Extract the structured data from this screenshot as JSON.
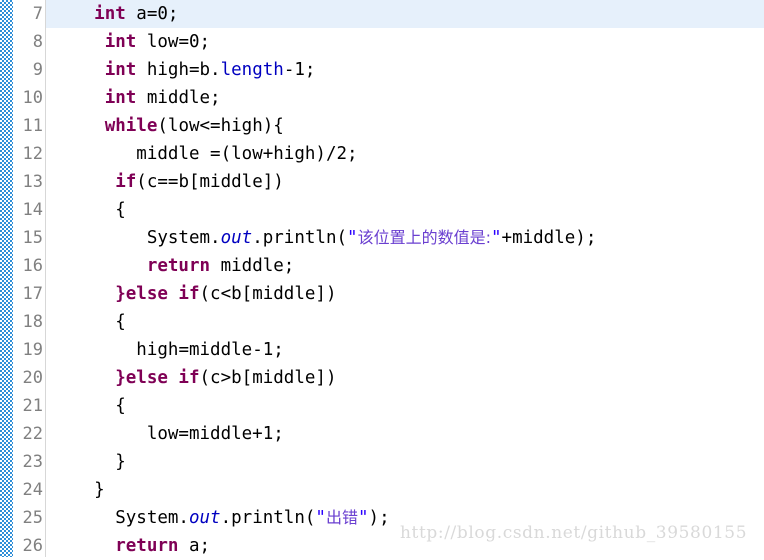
{
  "editor": {
    "language": "java",
    "first_line_number": 7,
    "line_height_px": 28,
    "current_line": 7,
    "colors": {
      "keyword": "#7f0055",
      "field": "#0000c0",
      "string": "#2a00ff",
      "plain": "#000000",
      "line_number": "#808080",
      "current_line_bg": "#e6f0fb",
      "change_strip": "#2f8fd8",
      "gutter_separator": "#d7d7d7",
      "watermark": "#d9d9d9"
    },
    "gutter": {
      "line_numbers": [
        "7",
        "8",
        "9",
        "10",
        "11",
        "12",
        "13",
        "14",
        "15",
        "16",
        "17",
        "18",
        "19",
        "20",
        "21",
        "22",
        "23",
        "24",
        "25",
        "26"
      ]
    },
    "lines": [
      {
        "n": "7",
        "indent": "    ",
        "tokens": [
          {
            "t": "kw",
            "v": "int"
          },
          {
            "t": "pln",
            "v": " a=0;"
          }
        ]
      },
      {
        "n": "8",
        "indent": "     ",
        "tokens": [
          {
            "t": "kw",
            "v": "int"
          },
          {
            "t": "pln",
            "v": " low=0;"
          }
        ]
      },
      {
        "n": "9",
        "indent": "     ",
        "tokens": [
          {
            "t": "kw",
            "v": "int"
          },
          {
            "t": "pln",
            "v": " high=b."
          },
          {
            "t": "fld",
            "v": "length"
          },
          {
            "t": "pln",
            "v": "-1;"
          }
        ]
      },
      {
        "n": "10",
        "indent": "     ",
        "tokens": [
          {
            "t": "kw",
            "v": "int"
          },
          {
            "t": "pln",
            "v": " middle;"
          }
        ]
      },
      {
        "n": "11",
        "indent": "     ",
        "tokens": [
          {
            "t": "kw",
            "v": "while"
          },
          {
            "t": "pln",
            "v": "(low<=high){"
          }
        ]
      },
      {
        "n": "12",
        "indent": "        ",
        "tokens": [
          {
            "t": "pln",
            "v": "middle =(low+high)/2;"
          }
        ]
      },
      {
        "n": "13",
        "indent": "      ",
        "tokens": [
          {
            "t": "kw",
            "v": "if"
          },
          {
            "t": "pln",
            "v": "(c==b[middle])"
          }
        ]
      },
      {
        "n": "14",
        "indent": "      ",
        "tokens": [
          {
            "t": "pln",
            "v": "{"
          }
        ]
      },
      {
        "n": "15",
        "indent": "         ",
        "tokens": [
          {
            "t": "pln",
            "v": "System."
          },
          {
            "t": "sfl",
            "v": "out"
          },
          {
            "t": "pln",
            "v": ".println("
          },
          {
            "t": "str",
            "v": "\""
          },
          {
            "t": "cjk",
            "v": "该位置上的数值是:"
          },
          {
            "t": "str",
            "v": "\""
          },
          {
            "t": "pln",
            "v": "+middle);"
          }
        ]
      },
      {
        "n": "16",
        "indent": "         ",
        "tokens": [
          {
            "t": "kw",
            "v": "return"
          },
          {
            "t": "pln",
            "v": " middle;"
          }
        ]
      },
      {
        "n": "17",
        "indent": "      ",
        "tokens": [
          {
            "t": "kw",
            "v": "}else if"
          },
          {
            "t": "pln",
            "v": "(c<b[middle])"
          }
        ]
      },
      {
        "n": "18",
        "indent": "      ",
        "tokens": [
          {
            "t": "pln",
            "v": "{"
          }
        ]
      },
      {
        "n": "19",
        "indent": "        ",
        "tokens": [
          {
            "t": "pln",
            "v": "high=middle-1;"
          }
        ]
      },
      {
        "n": "20",
        "indent": "      ",
        "tokens": [
          {
            "t": "kw",
            "v": "}else if"
          },
          {
            "t": "pln",
            "v": "(c>b[middle])"
          }
        ]
      },
      {
        "n": "21",
        "indent": "      ",
        "tokens": [
          {
            "t": "pln",
            "v": "{"
          }
        ]
      },
      {
        "n": "22",
        "indent": "         ",
        "tokens": [
          {
            "t": "pln",
            "v": "low=middle+1;"
          }
        ]
      },
      {
        "n": "23",
        "indent": "      ",
        "tokens": [
          {
            "t": "pln",
            "v": "}"
          }
        ]
      },
      {
        "n": "24",
        "indent": "    ",
        "tokens": [
          {
            "t": "pln",
            "v": "}"
          }
        ]
      },
      {
        "n": "25",
        "indent": "      ",
        "tokens": [
          {
            "t": "pln",
            "v": "System."
          },
          {
            "t": "sfl",
            "v": "out"
          },
          {
            "t": "pln",
            "v": ".println("
          },
          {
            "t": "str",
            "v": "\""
          },
          {
            "t": "cjk",
            "v": "出错"
          },
          {
            "t": "str",
            "v": "\""
          },
          {
            "t": "pln",
            "v": ");"
          }
        ]
      },
      {
        "n": "26",
        "indent": "      ",
        "tokens": [
          {
            "t": "kw",
            "v": "return"
          },
          {
            "t": "pln",
            "v": " a;"
          }
        ]
      }
    ]
  },
  "watermark": {
    "text": "http://blog.csdn.net/github_39580155"
  }
}
